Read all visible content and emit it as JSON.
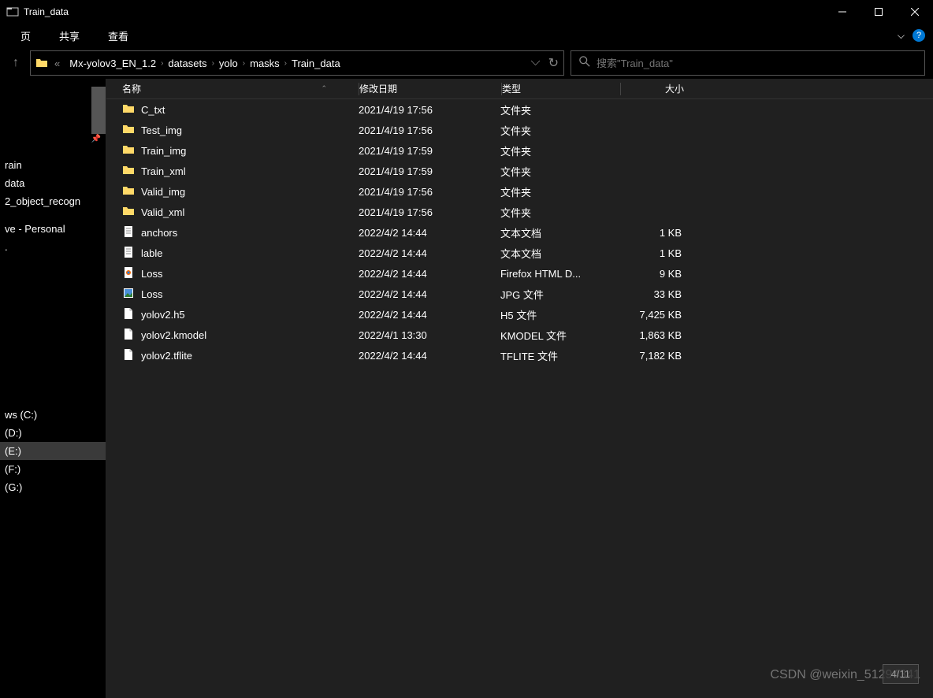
{
  "window": {
    "title": "Train_data"
  },
  "ribbon": {
    "tab_home": "页",
    "tab_share": "共享",
    "tab_view": "查看"
  },
  "nav": {
    "history_chev": "«",
    "crumbs": [
      "Mx-yolov3_EN_1.2",
      "datasets",
      "yolo",
      "masks",
      "Train_data"
    ]
  },
  "search": {
    "placeholder": "搜索\"Train_data\""
  },
  "sidebar": {
    "quick": [
      {
        "label": "",
        "pin": true
      },
      {
        "label": "",
        "pin": true
      },
      {
        "label": "",
        "pin": true
      },
      {
        "label": "",
        "pin": true
      }
    ],
    "items": [
      {
        "label": "rain"
      },
      {
        "label": "data"
      },
      {
        "label": "2_object_recogn"
      },
      {
        "label": "ve - Personal"
      },
      {
        "label": "."
      },
      {
        "label": "ws (C:)"
      },
      {
        "label": "(D:)"
      },
      {
        "label": "(E:)",
        "sel": true
      },
      {
        "label": "(F:)"
      },
      {
        "label": "(G:)"
      }
    ]
  },
  "columns": {
    "name": "名称",
    "date": "修改日期",
    "type": "类型",
    "size": "大小"
  },
  "files": [
    {
      "icon": "folder",
      "name": "C_txt",
      "date": "2021/4/19 17:56",
      "type": "文件夹",
      "size": ""
    },
    {
      "icon": "folder",
      "name": "Test_img",
      "date": "2021/4/19 17:56",
      "type": "文件夹",
      "size": ""
    },
    {
      "icon": "folder",
      "name": "Train_img",
      "date": "2021/4/19 17:59",
      "type": "文件夹",
      "size": ""
    },
    {
      "icon": "folder",
      "name": "Train_xml",
      "date": "2021/4/19 17:59",
      "type": "文件夹",
      "size": ""
    },
    {
      "icon": "folder",
      "name": "Valid_img",
      "date": "2021/4/19 17:56",
      "type": "文件夹",
      "size": ""
    },
    {
      "icon": "folder",
      "name": "Valid_xml",
      "date": "2021/4/19 17:56",
      "type": "文件夹",
      "size": ""
    },
    {
      "icon": "txt",
      "name": "anchors",
      "date": "2022/4/2 14:44",
      "type": "文本文档",
      "size": "1 KB"
    },
    {
      "icon": "txt",
      "name": "lable",
      "date": "2022/4/2 14:44",
      "type": "文本文档",
      "size": "1 KB"
    },
    {
      "icon": "html",
      "name": "Loss",
      "date": "2022/4/2 14:44",
      "type": "Firefox HTML D...",
      "size": "9 KB"
    },
    {
      "icon": "jpg",
      "name": "Loss",
      "date": "2022/4/2 14:44",
      "type": "JPG 文件",
      "size": "33 KB"
    },
    {
      "icon": "file",
      "name": "yolov2.h5",
      "date": "2022/4/2 14:44",
      "type": "H5 文件",
      "size": "7,425 KB"
    },
    {
      "icon": "file",
      "name": "yolov2.kmodel",
      "date": "2022/4/1 13:30",
      "type": "KMODEL 文件",
      "size": "1,863 KB"
    },
    {
      "icon": "file",
      "name": "yolov2.tflite",
      "date": "2022/4/2 14:44",
      "type": "TFLITE 文件",
      "size": "7,182 KB"
    }
  ],
  "watermark": "CSDN @weixin_51294341",
  "pagenum": "4/11"
}
